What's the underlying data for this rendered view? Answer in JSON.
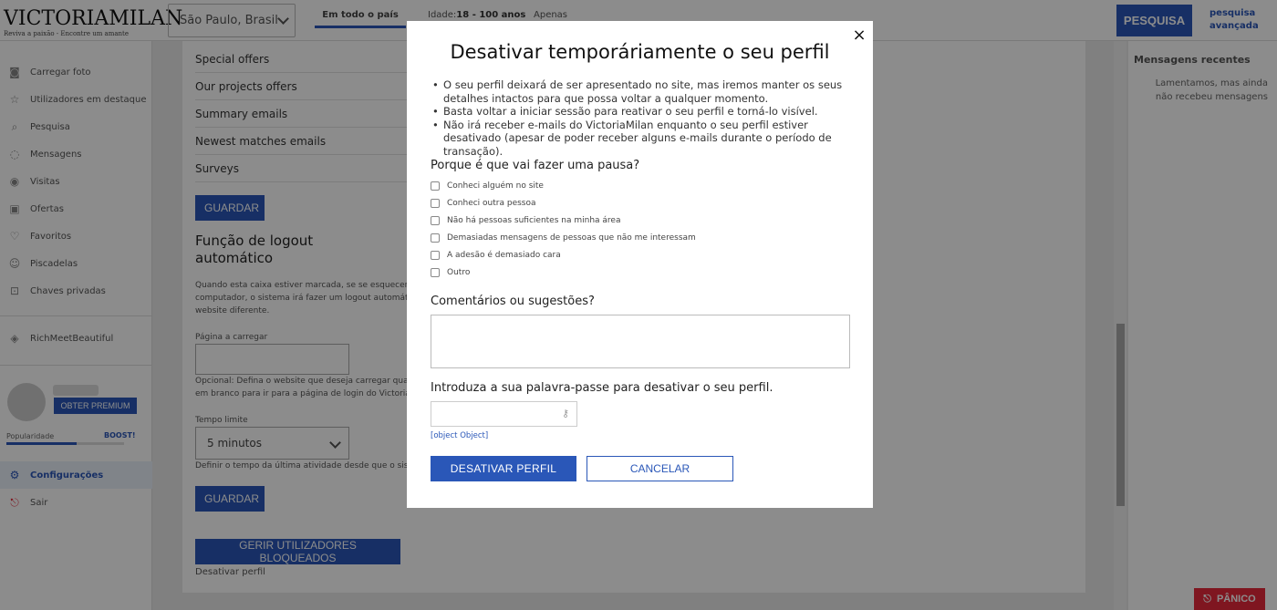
{
  "header": {
    "logo_text": "VICTORIAMILAN",
    "logo_tagline": "Reviva a paixão - Encontre um amante",
    "location": "São Paulo, Brasil",
    "scope_tab": "Em todo o país",
    "age_label": "Idade:",
    "age_value": "18 - 100 anos",
    "only_label": "Apenas",
    "search_button": "PESQUISA",
    "advanced_search": "pesquisa avançada"
  },
  "sidebar": {
    "items": [
      {
        "label": "Carregar foto",
        "icon": "camera-icon"
      },
      {
        "label": "Utilizadores em destaque",
        "icon": "star-icon"
      },
      {
        "label": "Pesquisa",
        "icon": "search-icon"
      },
      {
        "label": "Mensagens",
        "icon": "chat-icon"
      },
      {
        "label": "Visitas",
        "icon": "eye-icon"
      },
      {
        "label": "Ofertas",
        "icon": "gift-icon"
      },
      {
        "label": "Favoritos",
        "icon": "heart-icon"
      },
      {
        "label": "Piscadelas",
        "icon": "wink-icon"
      },
      {
        "label": "Chaves privadas",
        "icon": "lock-icon"
      }
    ],
    "partner": {
      "label": "RichMeetBeautiful",
      "icon": "diamond-icon"
    },
    "premium_button": "OBTER PREMIUM",
    "popularity_label": "Popularidade",
    "boost_label": "BOOST!",
    "popularity_fraction": 0.6,
    "settings": {
      "label": "Configurações",
      "icon": "gear-icon"
    },
    "logout": {
      "label": "Sair",
      "icon": "exit-icon"
    }
  },
  "main": {
    "options": [
      "Special offers",
      "Our projects offers",
      "Summary emails",
      "Newest matches emails",
      "Surveys"
    ],
    "save_button": "GUARDAR",
    "logout_title": "Função de logout automático",
    "logout_desc_1": "Quando esta caixa estiver marcada, se se esquecer d",
    "logout_desc_2": "computador, o sistema irá fazer um logout automátic",
    "logout_desc_3": "website diferente.",
    "page_label": "Página a carregar",
    "page_hint_1": "Opcional: Defina o website que deseja carregar quar",
    "page_hint_2": "em branco para ir para a página de login do Victoria",
    "time_label": "Tempo limite",
    "time_value": "5 minutos",
    "time_hint": "Definir o tempo da última atividade desde que o sist",
    "save_button_2": "GUARDAR",
    "blocked_button": "GERIR UTILIZADORES BLOQUEADOS",
    "deactivate_link": "Desativar perfil"
  },
  "right_panel": {
    "title": "Mensagens recentes",
    "text": "Lamentamos, mas ainda não recebeu mensagens"
  },
  "panic_button": "PÂNICO",
  "modal": {
    "title": "Desativar temporáriamente o seu perfil",
    "bullets": [
      "O seu perfil deixará de ser apresentado no site, mas iremos manter os seus detalhes intactos para que possa voltar a qualquer momento.",
      "Basta voltar a iniciar sessão para reativar o seu perfil e torná-lo visível.",
      "Não irá receber e-mails do VictoriaMilan enquanto o seu perfil estiver desativado (apesar de poder receber alguns e-mails durante o período de transação)."
    ],
    "question": "Porque é que vai fazer uma pausa?",
    "reasons": [
      "Conheci alguém no site",
      "Conheci outra pessoa",
      "Não há pessoas suficientes na minha área",
      "Demasiadas mensagens de pessoas que não me interessam",
      "A adesão é demasiado cara",
      "Outro"
    ],
    "comments_label": "Comentários ou sugestões?",
    "password_label": "Introduza a sua palavra-passe para desativar o seu perfil.",
    "object_link": "[object Object]",
    "deactivate_button": "DESATIVAR PERFIL",
    "cancel_button": "CANCELAR",
    "close_icon": "×"
  }
}
